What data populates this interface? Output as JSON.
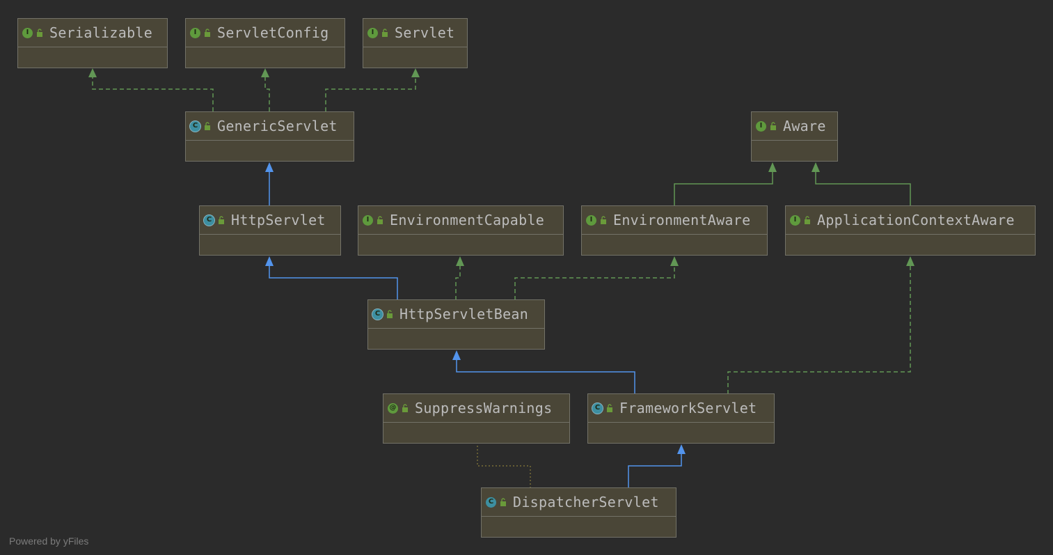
{
  "colors": {
    "background": "#2b2b2b",
    "node_fill": "#4a4637",
    "node_border": "#737268",
    "text": "#bcbcbc",
    "inheritance_edge": "#5394ec",
    "implements_edge": "#629755",
    "annotation_edge": "#8b7d3a",
    "interface_badge": "#5f9a3d",
    "class_badge": "#3d8fa1"
  },
  "nodes": {
    "serializable": {
      "name": "Serializable",
      "kind": "interface",
      "badge": "I",
      "icon": "interface-icon"
    },
    "servletconfig": {
      "name": "ServletConfig",
      "kind": "interface",
      "badge": "I",
      "icon": "interface-icon"
    },
    "servlet": {
      "name": "Servlet",
      "kind": "interface",
      "badge": "I",
      "icon": "interface-icon"
    },
    "genericservlet": {
      "name": "GenericServlet",
      "kind": "abstract",
      "badge": "C",
      "icon": "abstract-class-icon"
    },
    "aware": {
      "name": "Aware",
      "kind": "interface",
      "badge": "I",
      "icon": "interface-icon"
    },
    "httpservlet": {
      "name": "HttpServlet",
      "kind": "abstract",
      "badge": "C",
      "icon": "abstract-class-icon"
    },
    "environmentcapable": {
      "name": "EnvironmentCapable",
      "kind": "interface",
      "badge": "I",
      "icon": "interface-icon"
    },
    "environmentaware": {
      "name": "EnvironmentAware",
      "kind": "interface",
      "badge": "I",
      "icon": "interface-icon"
    },
    "applicationcontextaware": {
      "name": "ApplicationContextAware",
      "kind": "interface",
      "badge": "I",
      "icon": "interface-icon"
    },
    "httpservletbean": {
      "name": "HttpServletBean",
      "kind": "abstract",
      "badge": "C",
      "icon": "abstract-class-icon"
    },
    "suppresswarnings": {
      "name": "SuppressWarnings",
      "kind": "annotation",
      "badge": "@",
      "icon": "annotation-icon"
    },
    "frameworkservlet": {
      "name": "FrameworkServlet",
      "kind": "abstract",
      "badge": "C",
      "icon": "abstract-class-icon"
    },
    "dispatcherservlet": {
      "name": "DispatcherServlet",
      "kind": "class",
      "badge": "C",
      "icon": "class-icon"
    }
  },
  "edges": [
    {
      "from": "genericservlet",
      "to": "serializable",
      "type": "implements"
    },
    {
      "from": "genericservlet",
      "to": "servletconfig",
      "type": "implements"
    },
    {
      "from": "genericservlet",
      "to": "servlet",
      "type": "implements"
    },
    {
      "from": "httpservlet",
      "to": "genericservlet",
      "type": "extends"
    },
    {
      "from": "environmentaware",
      "to": "aware",
      "type": "extends-interface"
    },
    {
      "from": "applicationcontextaware",
      "to": "aware",
      "type": "extends-interface"
    },
    {
      "from": "httpservletbean",
      "to": "httpservlet",
      "type": "extends"
    },
    {
      "from": "httpservletbean",
      "to": "environmentcapable",
      "type": "implements"
    },
    {
      "from": "httpservletbean",
      "to": "environmentaware",
      "type": "implements"
    },
    {
      "from": "frameworkservlet",
      "to": "httpservletbean",
      "type": "extends"
    },
    {
      "from": "frameworkservlet",
      "to": "applicationcontextaware",
      "type": "implements"
    },
    {
      "from": "dispatcherservlet",
      "to": "frameworkservlet",
      "type": "extends"
    },
    {
      "from": "dispatcherservlet",
      "to": "suppresswarnings",
      "type": "annotated"
    }
  ],
  "footer": "Powered by yFiles"
}
